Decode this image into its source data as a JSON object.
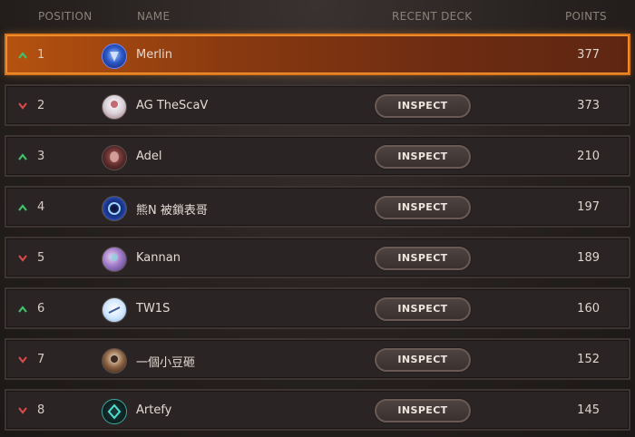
{
  "columns": {
    "position": "POSITION",
    "name": "NAME",
    "recent_deck": "RECENT DECK",
    "points": "POINTS"
  },
  "inspect_label": "INSPECT",
  "colors": {
    "up": "#3fc36b",
    "down": "#d9484a",
    "highlight": "#d9761d"
  },
  "rows": [
    {
      "trend": "up",
      "position": "1",
      "name": "Merlin",
      "points": "377",
      "has_inspect": false,
      "avatar_icon": "blue-emblem-avatar-icon"
    },
    {
      "trend": "down",
      "position": "2",
      "name": "AG TheScaV",
      "points": "373",
      "has_inspect": true,
      "avatar_icon": "white-figure-avatar-icon"
    },
    {
      "trend": "up",
      "position": "3",
      "name": "Adel",
      "points": "210",
      "has_inspect": true,
      "avatar_icon": "red-skull-avatar-icon"
    },
    {
      "trend": "up",
      "position": "4",
      "name": "熊N 被鎖表哥",
      "points": "197",
      "has_inspect": true,
      "avatar_icon": "blue-ring-avatar-icon"
    },
    {
      "trend": "down",
      "position": "5",
      "name": "Kannan",
      "points": "189",
      "has_inspect": true,
      "avatar_icon": "purple-figure-avatar-icon"
    },
    {
      "trend": "up",
      "position": "6",
      "name": "TW1S",
      "points": "160",
      "has_inspect": true,
      "avatar_icon": "light-blue-avatar-icon"
    },
    {
      "trend": "down",
      "position": "7",
      "name": "一個小豆砸",
      "points": "152",
      "has_inspect": true,
      "avatar_icon": "brown-character-avatar-icon"
    },
    {
      "trend": "down",
      "position": "8",
      "name": "Artefy",
      "points": "145",
      "has_inspect": true,
      "avatar_icon": "teal-crest-avatar-icon"
    }
  ]
}
